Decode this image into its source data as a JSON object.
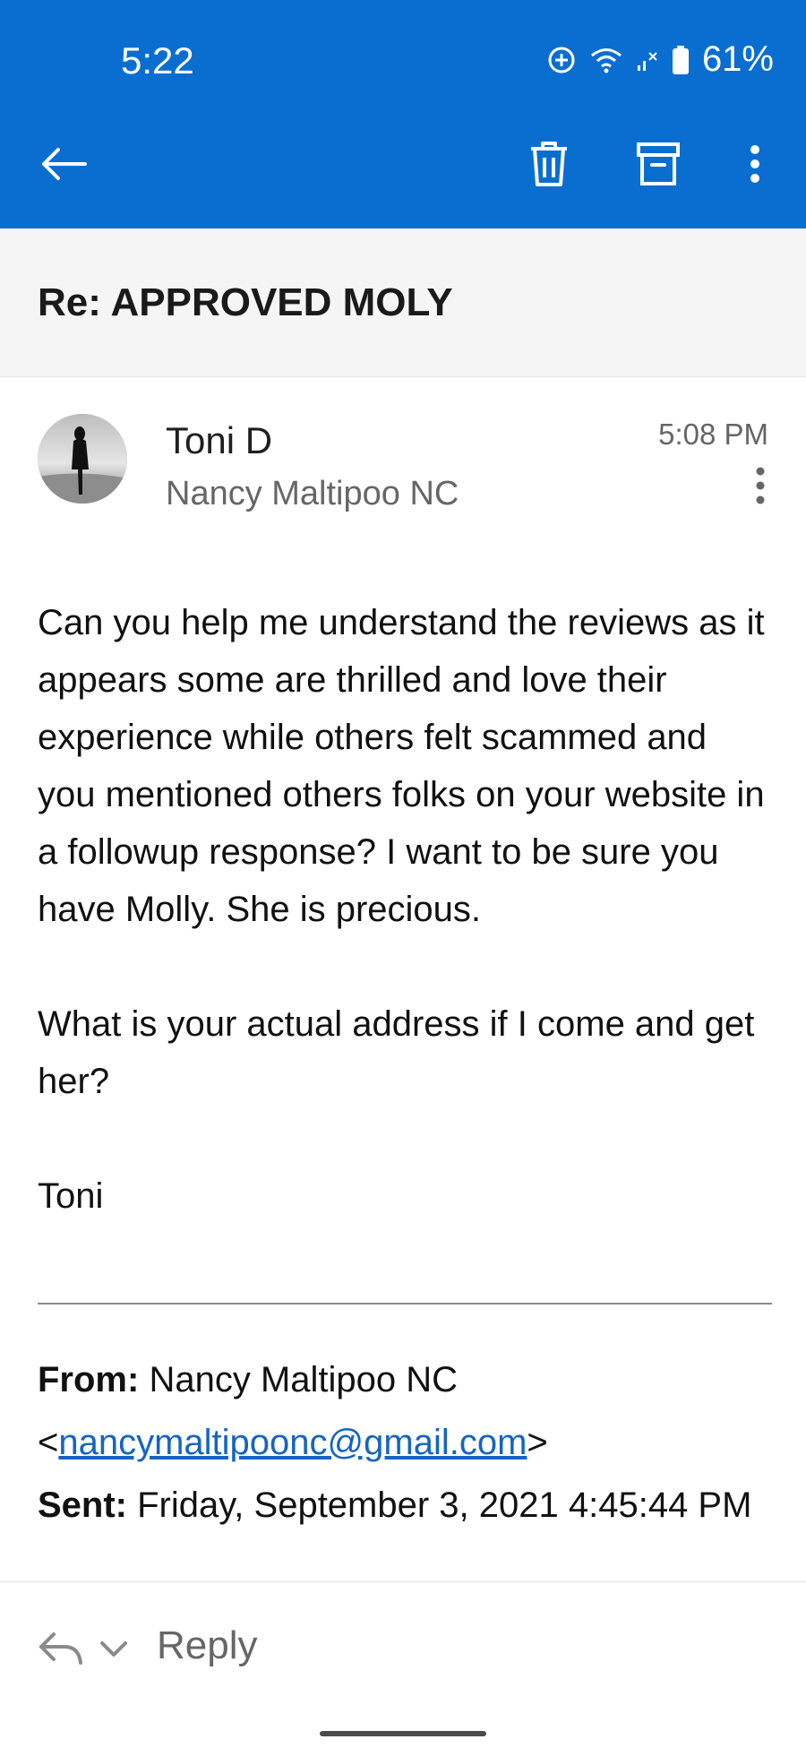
{
  "status_bar": {
    "time": "5:22",
    "battery": "61%"
  },
  "toolbar": {
    "back_icon": "arrow-left-icon",
    "delete_icon": "trash-icon",
    "archive_icon": "archive-icon",
    "more_icon": "more-vertical-icon",
    "bg_color": "#0a6ed1"
  },
  "email": {
    "subject": "Re: APPROVED MOLY",
    "sender_name": "Toni D",
    "recipient": "Nancy Maltipoo NC",
    "time": "5:08 PM",
    "body_paragraphs": [
      "Can you help me understand the reviews as it appears some are thrilled and love their experience while others felt scammed and you mentioned others folks on your website in a followup response? I want to be sure you have Molly. She is precious.",
      "What is your actual address if I come and get her?",
      "Toni"
    ],
    "quoted": {
      "from_label": "From:",
      "from_name": "Nancy Maltipoo NC",
      "from_email": "nancymaltipoonc@gmail.com",
      "sent_label": "Sent:",
      "sent_value": "Friday, September 3, 2021 4:45:44 PM"
    }
  },
  "bottom_bar": {
    "reply_label": "Reply"
  }
}
